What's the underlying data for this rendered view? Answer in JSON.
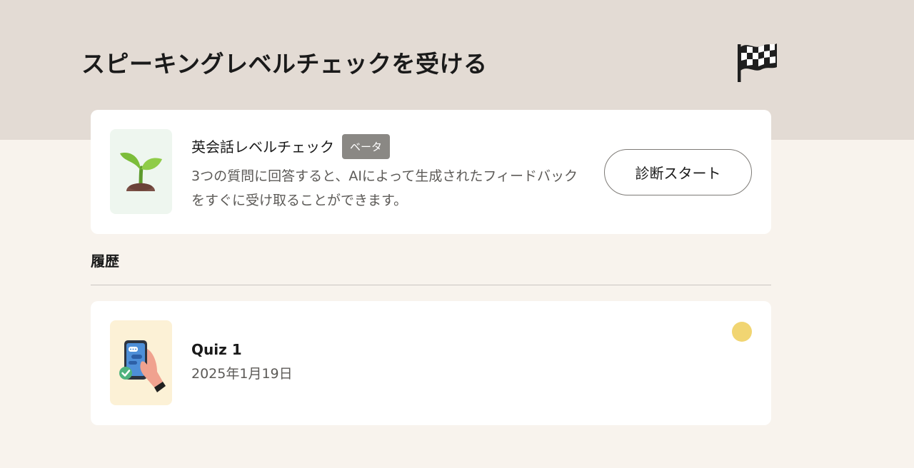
{
  "header": {
    "title": "スピーキングレベルチェックを受ける",
    "icon": "checkered-flag-icon"
  },
  "level_check": {
    "icon": "seedling-icon",
    "title": "英会話レベルチェック",
    "badge": "ベータ",
    "description": "3つの質問に回答すると、AIによって生成されたフィードバックをすぐに受け取ることができます。",
    "start_button": "診断スタート"
  },
  "history": {
    "heading": "履歴",
    "items": [
      {
        "icon": "phone-chat-icon",
        "title": "Quiz 1",
        "date": "2025年1月19日",
        "status_color": "#f1d572"
      }
    ]
  },
  "colors": {
    "header_bg": "#e3dbd4",
    "page_bg": "#f8f3ed",
    "badge_bg": "#8a8884",
    "status_dot": "#f1d572"
  }
}
